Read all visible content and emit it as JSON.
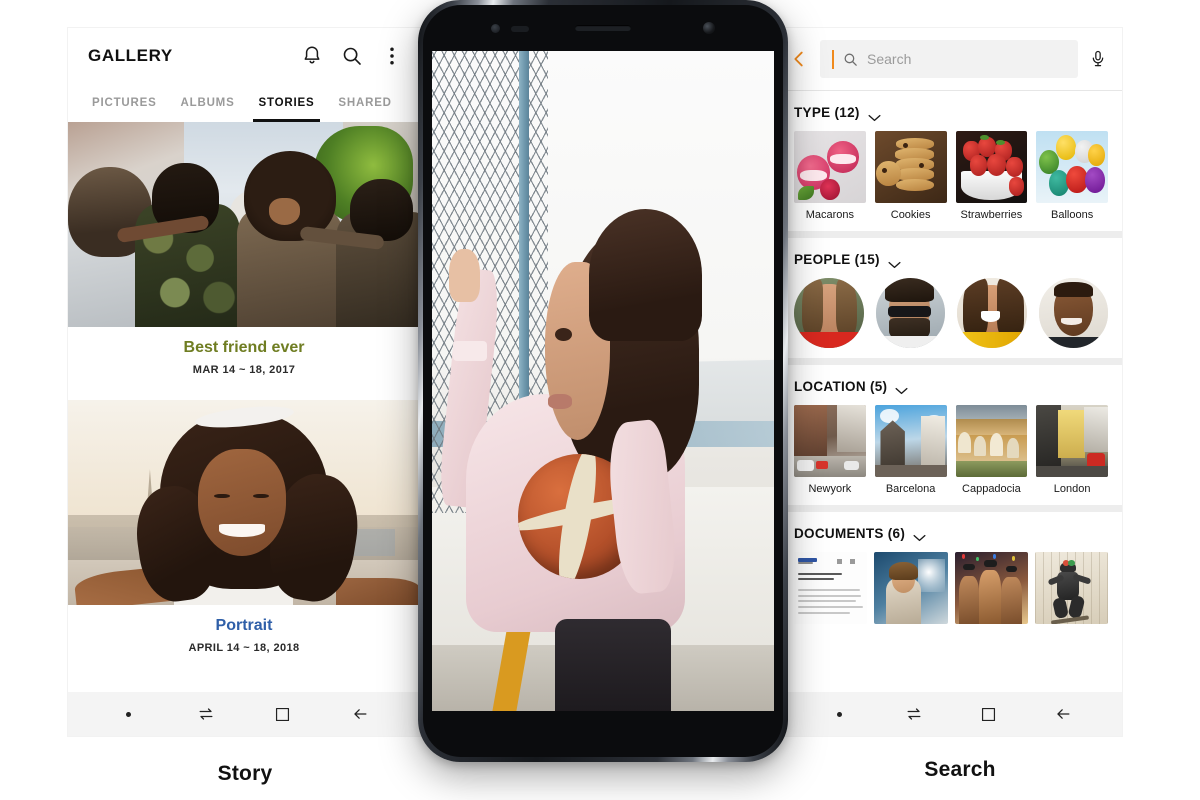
{
  "left_device": {
    "caption": "Story",
    "header": {
      "title": "GALLERY",
      "icons": [
        {
          "name": "notification-bell-icon",
          "label": "Notifications"
        },
        {
          "name": "search-icon",
          "label": "Search"
        },
        {
          "name": "more-options-icon",
          "label": "More options"
        }
      ]
    },
    "tabs": [
      {
        "label": "PICTURES",
        "active": false
      },
      {
        "label": "ALBUMS",
        "active": false
      },
      {
        "label": "STORIES",
        "active": true
      },
      {
        "label": "SHARED",
        "active": false
      }
    ],
    "stories": [
      {
        "title": "Best friend ever",
        "date": "MAR 14 ~ 18, 2017",
        "title_color": "#6f7d22",
        "photo_alt": "Four friends walking with arms around each other on a sunny street"
      },
      {
        "title": "Portrait",
        "date": "APRIL 14 ~ 18, 2018",
        "title_color": "#2f5fa8",
        "photo_alt": "Smiling woman taking a selfie outdoors at sunset"
      }
    ],
    "navbar": [
      {
        "name": "nav-dot-button",
        "label": "Dot"
      },
      {
        "name": "nav-recents-button",
        "label": "Recents"
      },
      {
        "name": "nav-home-button",
        "label": "Home"
      },
      {
        "name": "nav-back-button",
        "label": "Back"
      }
    ]
  },
  "center_device": {
    "screen_alt": "Woman in a pink sweatshirt holding a basketball beside a chain-link fence"
  },
  "right_device": {
    "caption": "Search",
    "search": {
      "back_label": "Back",
      "placeholder": "Search",
      "value": "",
      "mic_label": "Voice search",
      "caret_color": "#f08a1d",
      "back_chevron_color": "#f08a1d"
    },
    "sections": [
      {
        "title": "TYPE (12)",
        "kind": "thumbs",
        "items": [
          {
            "label": "Macarons"
          },
          {
            "label": "Cookies"
          },
          {
            "label": "Strawberries"
          },
          {
            "label": "Balloons"
          }
        ]
      },
      {
        "title": "PEOPLE (15)",
        "kind": "avatars",
        "items": [
          {
            "label": ""
          },
          {
            "label": ""
          },
          {
            "label": ""
          },
          {
            "label": ""
          }
        ]
      },
      {
        "title": "LOCATION (5)",
        "kind": "thumbs",
        "items": [
          {
            "label": "Newyork"
          },
          {
            "label": "Barcelona"
          },
          {
            "label": "Cappadocia"
          },
          {
            "label": "London"
          }
        ]
      },
      {
        "title": "DOCUMENTS (6)",
        "kind": "documents",
        "items": [
          {
            "label": ""
          },
          {
            "label": ""
          },
          {
            "label": ""
          },
          {
            "label": ""
          }
        ]
      }
    ],
    "navbar": [
      {
        "name": "nav-dot-button",
        "label": "Dot"
      },
      {
        "name": "nav-recents-button",
        "label": "Recents"
      },
      {
        "name": "nav-home-button",
        "label": "Home"
      },
      {
        "name": "nav-back-button",
        "label": "Back"
      }
    ]
  }
}
